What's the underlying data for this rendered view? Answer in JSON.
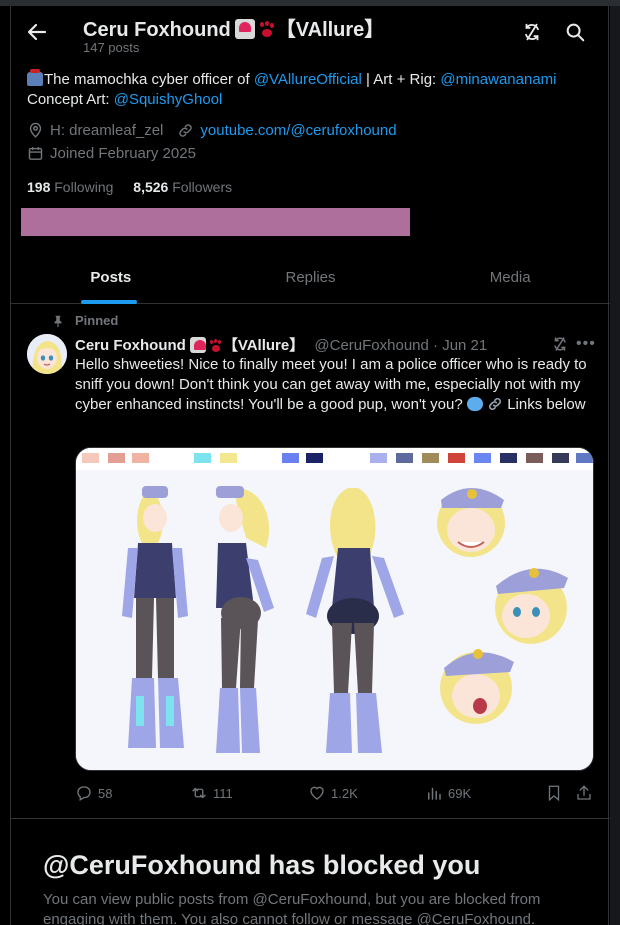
{
  "header": {
    "display_name": "Ceru Foxhound",
    "name_suffix": "【VAllure】",
    "post_count": "147 posts"
  },
  "bio": {
    "line1_prefix": "The mamochka cyber officer of ",
    "mention_official": "@VAllureOfficial",
    "line1_mid": " | Art + Rig: ",
    "mention_rig": "@minawananami",
    "line2_prefix": "Concept Art: ",
    "mention_concept": "@SquishyGhool",
    "location": "H: dreamleaf_zel",
    "website": "youtube.com/@cerufoxhound",
    "joined": "Joined February 2025"
  },
  "stats": {
    "following_count": "198",
    "following_label": " Following",
    "followers_count": "8,526",
    "followers_label": " Followers"
  },
  "redaction_color": "#ae6f9c",
  "tabs": [
    {
      "label": "Posts",
      "active": true
    },
    {
      "label": "Replies",
      "active": false
    },
    {
      "label": "Media",
      "active": false
    }
  ],
  "post": {
    "pinned_label": "Pinned",
    "author_name": "Ceru Foxhound",
    "author_suffix": "【VAllure】",
    "handle": "@CeruFoxhound",
    "date": "· Jun 21",
    "text": "Hello shweeties! Nice to finally meet you! I am a police officer who is ready to sniff you down! Don't think you can get away with me, especially not with my cyber enhanced instincts! You'll be a good pup, won't you?",
    "text_tail": "Links below",
    "media_icon": "character-reference-sheet-image",
    "palette": [
      "#f6c9bd",
      "#e39f94",
      "#f0b3a3",
      "#7de3ef",
      "#f4e88e",
      "#6a7ff0",
      "#1b2367",
      "#aab0ee",
      "#5c6b9c",
      "#a08c58",
      "#d1443a",
      "#6a86f0",
      "#283064",
      "#7a5c5a",
      "#363b5a",
      "#6078c4"
    ],
    "replies": "58",
    "reposts": "111",
    "likes": "1.2K",
    "views": "69K"
  },
  "blocked": {
    "title": "@CeruFoxhound has blocked you",
    "body": "You can view public posts from @CeruFoxhound, but you are blocked from engaging with them. You also cannot follow or message @CeruFoxhound."
  },
  "colors": {
    "accent": "#1d9bf0",
    "background": "#000000",
    "muted": "#71767b",
    "border": "#2f3336"
  }
}
